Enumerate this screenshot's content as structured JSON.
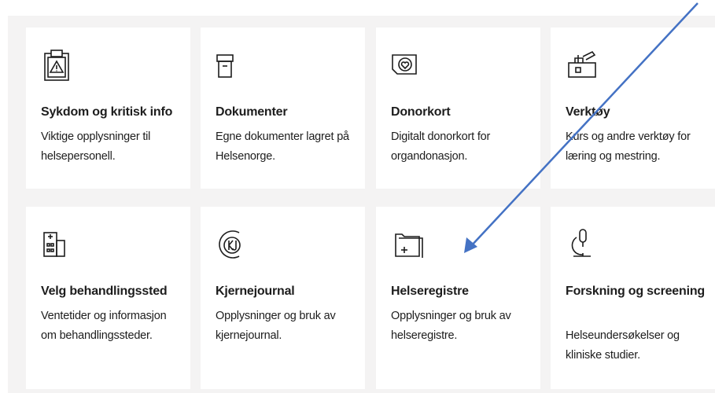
{
  "cards": [
    {
      "title": "Sykdom og kritisk info",
      "description": "Viktige opplysninger til helsepersonell.",
      "icon": "clipboard-warning-icon"
    },
    {
      "title": "Dokumenter",
      "description": "Egne dokumenter lagret på Helsenorge.",
      "icon": "archive-box-icon"
    },
    {
      "title": "Donorkort",
      "description": "Digitalt donorkort for organdonasjon.",
      "icon": "donor-card-icon"
    },
    {
      "title": "Verktøy",
      "description": "Kurs og andre verktøy for læring og mestring.",
      "icon": "toolbox-icon"
    },
    {
      "title": "Velg behandlingssted",
      "description": "Ventetider og informasjon om behandlingssteder.",
      "icon": "hospital-building-icon"
    },
    {
      "title": "Kjernejournal",
      "description": "Opplysninger og bruk av kjernejournal.",
      "icon": "kjernejournal-logo-icon"
    },
    {
      "title": "Helseregistre",
      "description": "Opplysninger og bruk av helseregistre.",
      "icon": "folder-plus-icon"
    },
    {
      "title": "Forskning og screening",
      "description": "Helseundersøkelser og kliniske studier.",
      "icon": "microscope-icon"
    }
  ],
  "annotation": {
    "type": "arrow",
    "color": "#4472c4",
    "points_to": "Helseregistre"
  }
}
